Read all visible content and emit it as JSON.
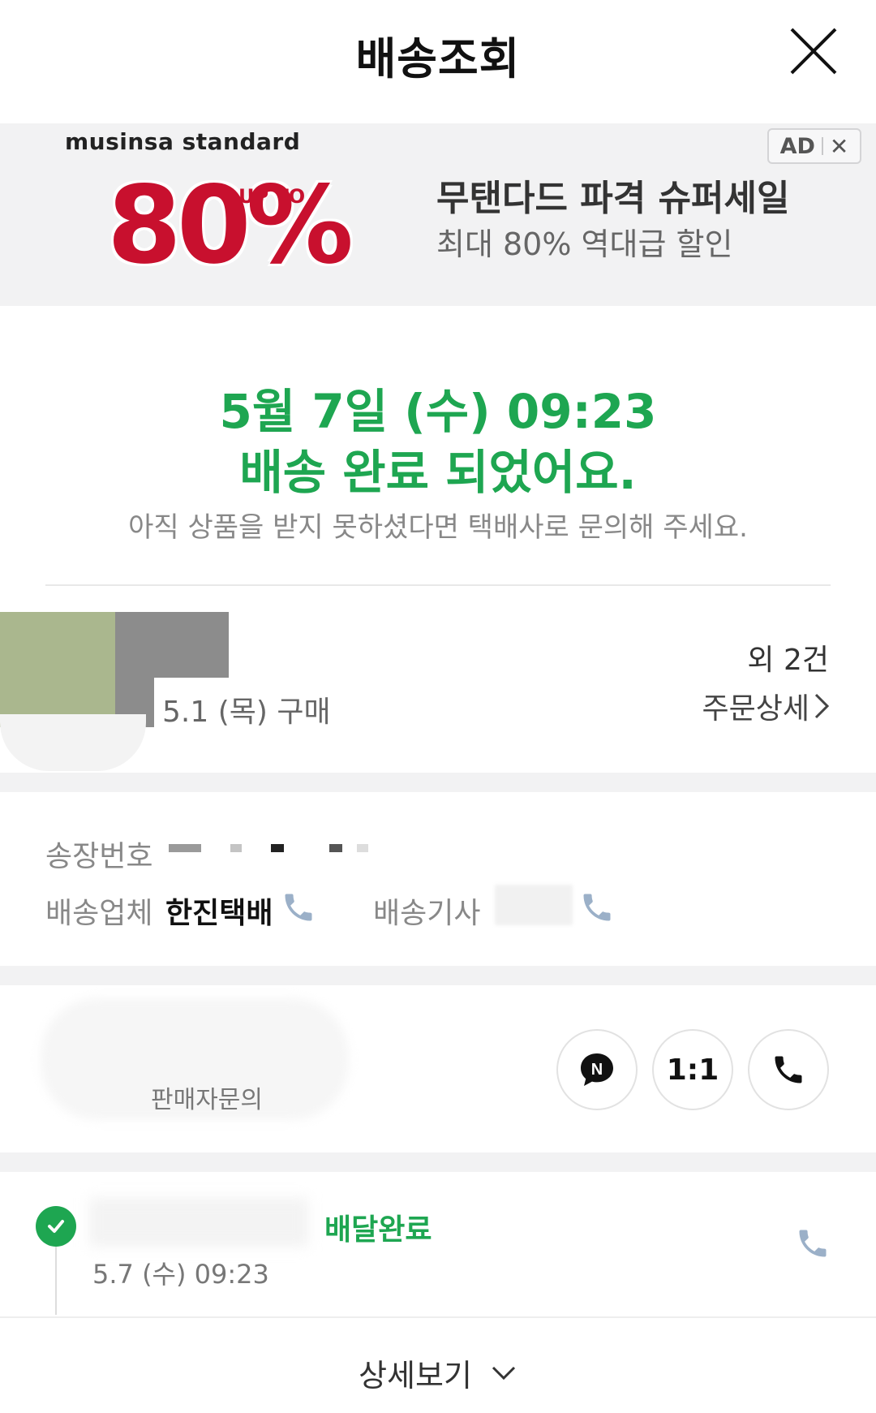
{
  "header": {
    "title": "배송조회",
    "close_icon": "close-icon"
  },
  "ad": {
    "brand": "musinsa standard",
    "big_text": "80%",
    "up_to": "UP TO",
    "title": "무탠다드 파격 슈퍼세일",
    "subtitle": "최대 80% 역대급 할인",
    "badge_label": "AD",
    "badge_close": "✕",
    "colors": {
      "sale_red": "#c8102e",
      "background": "#f2f2f3"
    }
  },
  "status": {
    "date": "5월 7일 (수) 09:23",
    "message": "배송 완료 되었어요.",
    "note": "아직 상품을 받지 못하셨다면 택배사로 문의해 주세요.",
    "accent_color": "#1ea651"
  },
  "order": {
    "purchase_date": "5.1 (목) 구매",
    "more_count": "외 2건",
    "detail_link": "주문상세"
  },
  "shipment": {
    "invoice_label": "송장번호",
    "carrier_label": "배송업체",
    "carrier_name": "한진택배",
    "driver_label": "배송기사"
  },
  "seller": {
    "inquiry_label": "판매자문의",
    "buttons": [
      {
        "name": "naver-talk-button",
        "icon": "naver-talk-icon",
        "label": "N"
      },
      {
        "name": "one-to-one-button",
        "label": "1:1"
      },
      {
        "name": "call-seller-button",
        "icon": "phone-icon"
      }
    ]
  },
  "tracking": {
    "steps": [
      {
        "status": "배달완료",
        "time": "5.7 (수) 09:23",
        "done": true
      }
    ]
  },
  "footer": {
    "detail_label": "상세보기"
  }
}
